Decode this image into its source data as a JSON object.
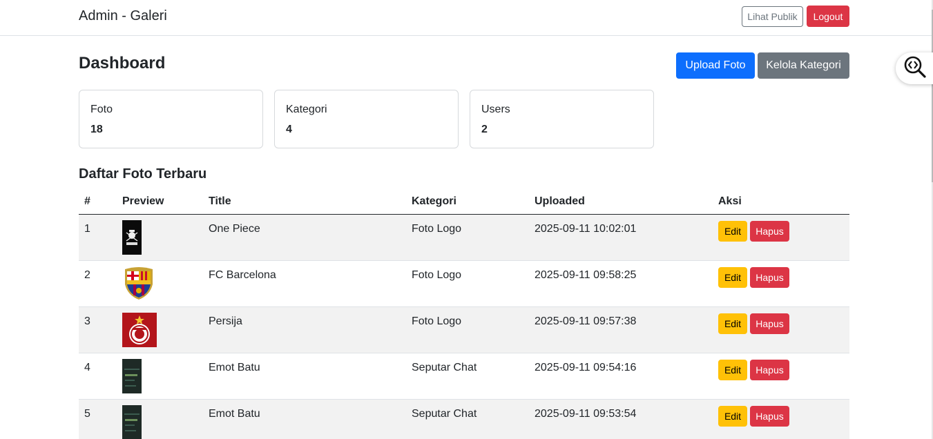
{
  "navbar": {
    "brand": "Admin - Galeri",
    "public_label": "Lihat Publik",
    "logout_label": "Logout"
  },
  "header": {
    "title": "Dashboard",
    "upload_label": "Upload Foto",
    "category_label": "Kelola Kategori"
  },
  "stats": [
    {
      "label": "Foto",
      "value": "18"
    },
    {
      "label": "Kategori",
      "value": "4"
    },
    {
      "label": "Users",
      "value": "2"
    }
  ],
  "section": {
    "title": "Daftar Foto Terbaru"
  },
  "table": {
    "headers": [
      "#",
      "Preview",
      "Title",
      "Kategori",
      "Uploaded",
      "Aksi"
    ],
    "edit_label": "Edit",
    "delete_label": "Hapus",
    "rows": [
      {
        "no": "1",
        "title": "One Piece",
        "kategori": "Foto Logo",
        "uploaded": "2025-09-11 10:02:01"
      },
      {
        "no": "2",
        "title": "FC Barcelona",
        "kategori": "Foto Logo",
        "uploaded": "2025-09-11 09:58:25"
      },
      {
        "no": "3",
        "title": "Persija",
        "kategori": "Foto Logo",
        "uploaded": "2025-09-11 09:57:38"
      },
      {
        "no": "4",
        "title": "Emot Batu",
        "kategori": "Seputar Chat",
        "uploaded": "2025-09-11 09:54:16"
      },
      {
        "no": "5",
        "title": "Emot Batu",
        "kategori": "Seputar Chat",
        "uploaded": "2025-09-11 09:53:54"
      }
    ]
  },
  "colors": {
    "primary": "#0d6efd",
    "secondary": "#6c757d",
    "danger": "#dc3545",
    "warning": "#ffc107"
  }
}
